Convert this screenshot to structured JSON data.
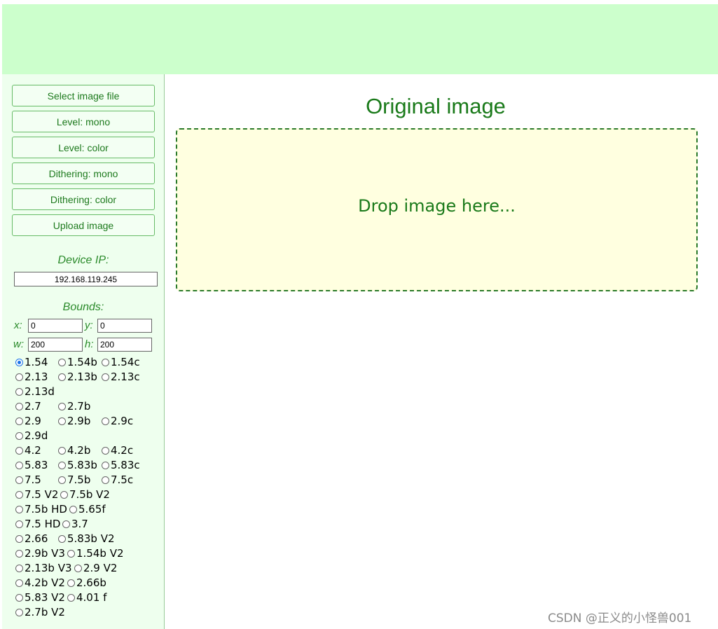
{
  "sidebar": {
    "buttons": [
      {
        "label": "Select image file"
      },
      {
        "label": "Level: mono"
      },
      {
        "label": "Level: color"
      },
      {
        "label": "Dithering: mono"
      },
      {
        "label": "Dithering: color"
      },
      {
        "label": "Upload image"
      }
    ],
    "device_ip_label": "Device IP:",
    "device_ip_value": "192.168.119.245",
    "bounds_label": "Bounds:",
    "bounds": {
      "x_label": "x:",
      "x_value": "0",
      "y_label": "y:",
      "y_value": "0",
      "w_label": "w:",
      "w_value": "200",
      "h_label": "h:",
      "h_value": "200"
    },
    "selected_display": "1.54",
    "display_rows": [
      [
        "1.54",
        "1.54b",
        "1.54c"
      ],
      [
        "2.13",
        "2.13b",
        "2.13c"
      ],
      [
        "2.13d"
      ],
      [
        "2.7",
        "2.7b"
      ],
      [
        "2.9",
        "2.9b",
        "2.9c"
      ],
      [
        "2.9d"
      ],
      [
        "4.2",
        "4.2b",
        "4.2c"
      ],
      [
        "5.83",
        "5.83b",
        "5.83c"
      ],
      [
        "7.5",
        "7.5b",
        "7.5c"
      ],
      [
        "7.5 V2",
        "7.5b V2"
      ],
      [
        "7.5b HD",
        "5.65f"
      ],
      [
        "7.5 HD",
        "3.7"
      ],
      [
        "2.66",
        "5.83b V2"
      ],
      [
        "2.9b V3",
        "1.54b V2"
      ],
      [
        "2.13b V3",
        "2.9 V2"
      ],
      [
        "4.2b V2",
        "2.66b"
      ],
      [
        "5.83 V2",
        "4.01 f"
      ],
      [
        "2.7b V2"
      ]
    ]
  },
  "main": {
    "title": "Original image",
    "drop_text": "Drop image here..."
  },
  "watermark": "CSDN @正义的小怪兽001",
  "colors": {
    "header_bg": "#ccffcc",
    "sidebar_bg": "#eeffee",
    "accent_green": "#1a7a1a",
    "dropzone_bg": "#ffffe0"
  }
}
